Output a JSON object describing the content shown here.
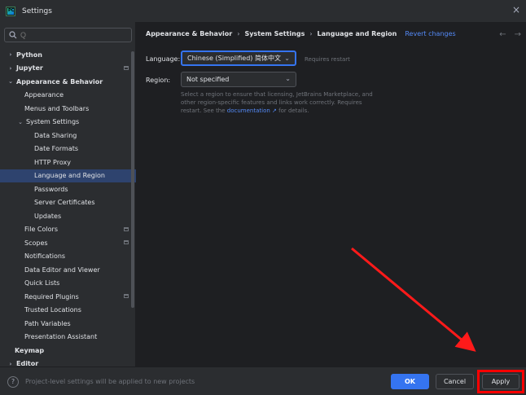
{
  "window": {
    "title": "Settings",
    "app_icon_text": "PC"
  },
  "search": {
    "placeholder": "Q"
  },
  "sidebar": {
    "items": [
      {
        "label": "Python",
        "chev": "›",
        "bold": true,
        "level": 0
      },
      {
        "label": "Jupyter",
        "chev": "›",
        "bold": true,
        "level": 0,
        "project": true
      },
      {
        "label": "Appearance & Behavior",
        "chev": "⌄",
        "bold": true,
        "level": 0
      },
      {
        "label": "Appearance",
        "level": 1
      },
      {
        "label": "Menus and Toolbars",
        "level": 1
      },
      {
        "label": "System Settings",
        "chev": "⌄",
        "level": 1
      },
      {
        "label": "Data Sharing",
        "level": 2
      },
      {
        "label": "Date Formats",
        "level": 2
      },
      {
        "label": "HTTP Proxy",
        "level": 2
      },
      {
        "label": "Language and Region",
        "level": 2,
        "selected": true
      },
      {
        "label": "Passwords",
        "level": 2
      },
      {
        "label": "Server Certificates",
        "level": 2
      },
      {
        "label": "Updates",
        "level": 2
      },
      {
        "label": "File Colors",
        "level": 1,
        "project": true
      },
      {
        "label": "Scopes",
        "level": 1,
        "project": true
      },
      {
        "label": "Notifications",
        "level": 1
      },
      {
        "label": "Data Editor and Viewer",
        "level": 1
      },
      {
        "label": "Quick Lists",
        "level": 1
      },
      {
        "label": "Required Plugins",
        "level": 1,
        "project": true
      },
      {
        "label": "Trusted Locations",
        "level": 1
      },
      {
        "label": "Path Variables",
        "level": 1
      },
      {
        "label": "Presentation Assistant",
        "level": 1
      },
      {
        "label": "Keymap",
        "bold": true,
        "level": 0
      },
      {
        "label": "Editor",
        "chev": "›",
        "bold": true,
        "level": 0
      }
    ]
  },
  "breadcrumb": {
    "part1": "Appearance & Behavior",
    "sep": "›",
    "part2": "System Settings",
    "part3": "Language and Region",
    "revert": "Revert changes",
    "back": "←",
    "forward": "→"
  },
  "form": {
    "language_label": "Language:",
    "language_value": "Chinese (Simplified) 简体中文",
    "requires_restart": "Requires restart",
    "region_label": "Region:",
    "region_value": "Not specified",
    "help_text": "Select a region to ensure that licensing, JetBrains Marketplace, and other region-specific features and links work correctly. Requires restart. See the",
    "help_link": "documentation ↗",
    "help_tail": "for details.",
    "chevron": "⌄"
  },
  "footer": {
    "help": "?",
    "note": "Project-level settings will be applied to new projects",
    "ok": "OK",
    "cancel": "Cancel",
    "apply": "Apply"
  },
  "colors": {
    "accent": "#3574f0",
    "selection": "#2e436e",
    "highlight": "#ff0000"
  }
}
